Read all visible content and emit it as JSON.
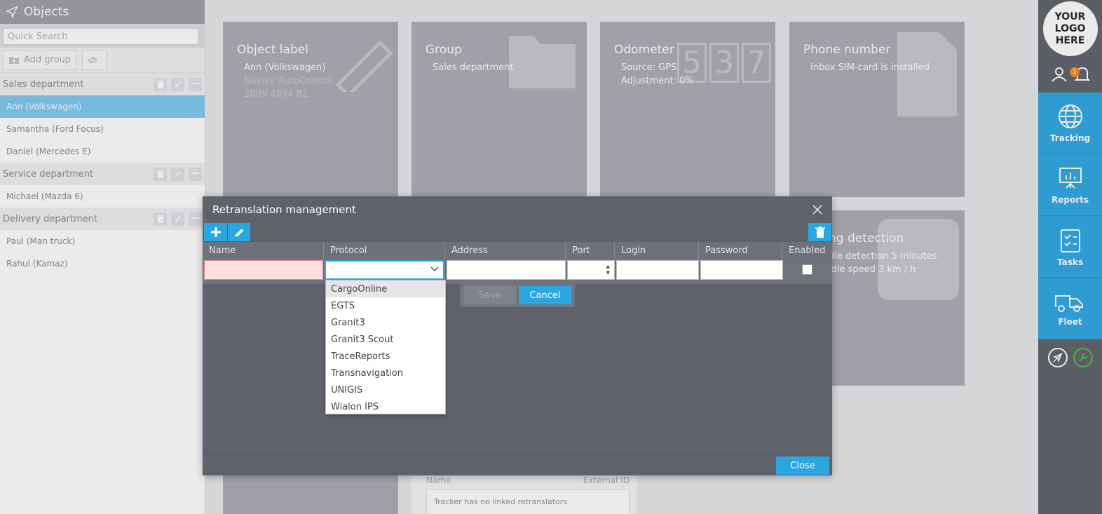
{
  "sidebar": {
    "title": "Objects",
    "search_placeholder": "Quick Search",
    "add_group_label": "Add group",
    "groups": [
      {
        "name": "Sales department",
        "items": [
          "Ann (Volkswagen)",
          "Samantha (Ford Focus)",
          "Daniel (Mercedes E)"
        ]
      },
      {
        "name": "Service department",
        "items": [
          "Michael (Mazda 6)"
        ]
      },
      {
        "name": "Delivery department",
        "items": [
          "Paul (Man truck)",
          "Rahul (Kamaz)"
        ]
      }
    ],
    "selected_item": "Ann (Volkswagen)"
  },
  "cards": {
    "object_label": {
      "title": "Object label",
      "lines": [
        "Ann (Volkswagen)",
        "Navixy AutoControl",
        "2809 4894 82"
      ]
    },
    "group": {
      "title": "Group",
      "lines": [
        "Sales department"
      ]
    },
    "odometer": {
      "title": "Odometer",
      "lines": [
        "Source: GPS",
        "Adjustment: 0%"
      ],
      "digits": [
        "5",
        "3",
        "7"
      ]
    },
    "phone": {
      "title": "Phone number",
      "lines": [
        "Inbox SIM-card is installed"
      ]
    },
    "parking": {
      "title": "ng detection",
      "lines": [
        "dle detection 5 minutes",
        "idle speed 3 km / h"
      ]
    },
    "retranslators": {
      "col_name": "Name",
      "col_external": "External ID",
      "empty_text": "Tracker has no linked retranslators"
    }
  },
  "rightbar": {
    "logo_text": [
      "YOUR",
      "LOGO",
      "HERE"
    ],
    "notification_count": "1",
    "nav": [
      "Tracking",
      "Reports",
      "Tasks",
      "Fleet"
    ],
    "accent_color": "#2aa6e1"
  },
  "modal": {
    "title": "Retranslation management",
    "columns": [
      "Name",
      "Protocol",
      "Address",
      "Port",
      "Login",
      "Password",
      "Enabled"
    ],
    "save_label": "Save",
    "cancel_label": "Cancel",
    "close_label": "Close",
    "protocol_options": [
      "CargoOnline",
      "EGTS",
      "Granit3",
      "Granit3 Scout",
      "TraceReports",
      "Transnavigation",
      "UNIGIS",
      "Wialon IPS"
    ],
    "highlighted_option": "CargoOnline"
  }
}
